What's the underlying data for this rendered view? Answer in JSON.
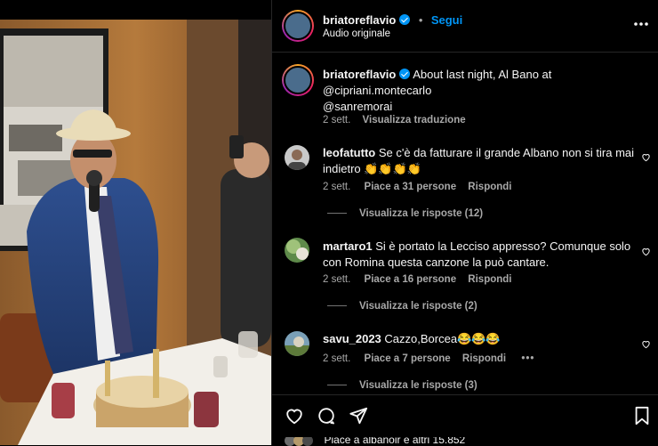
{
  "post": {
    "username": "briatoreflavio",
    "follow_label": "Segui",
    "audio": "Audio originale",
    "caption_user": "briatoreflavio",
    "caption_text": "About last night, Al Bano at",
    "mention1": "@cipriani.montecarlo",
    "mention2": "@sanremorai",
    "caption_time": "2 sett.",
    "translate_label": "Visualizza traduzione",
    "likes_text": "Piace a albanoir e altri 15.852"
  },
  "comments": [
    {
      "user": "leofatutto",
      "text": "Se c'è da fatturare il grande Albano non si tira mai indietro 👏👏👏👏",
      "time": "2 sett.",
      "likes": "Piace a 31 persone",
      "reply": "Rispondi",
      "view_replies": "Visualizza le risposte (12)"
    },
    {
      "user": "martaro1",
      "text": "Si è portato la Lecciso appresso? Comunque solo con Romina questa canzone la può cantare.",
      "time": "2 sett.",
      "likes": "Piace a 16 persone",
      "reply": "Rispondi",
      "view_replies": "Visualizza le risposte (2)"
    },
    {
      "user": "savu_2023",
      "text": "Cazzo,Borcea😂😂😂",
      "time": "2 sett.",
      "likes": "Piace a 7 persone",
      "reply": "Rispondi",
      "view_replies": "Visualizza le risposte (3)"
    }
  ],
  "icons": [
    "more-icon",
    "heart-icon",
    "comment-icon",
    "share-icon",
    "bookmark-icon"
  ],
  "colors": {
    "accent": "#0095f6",
    "background": "#000000",
    "muted": "#a8a8a8"
  }
}
